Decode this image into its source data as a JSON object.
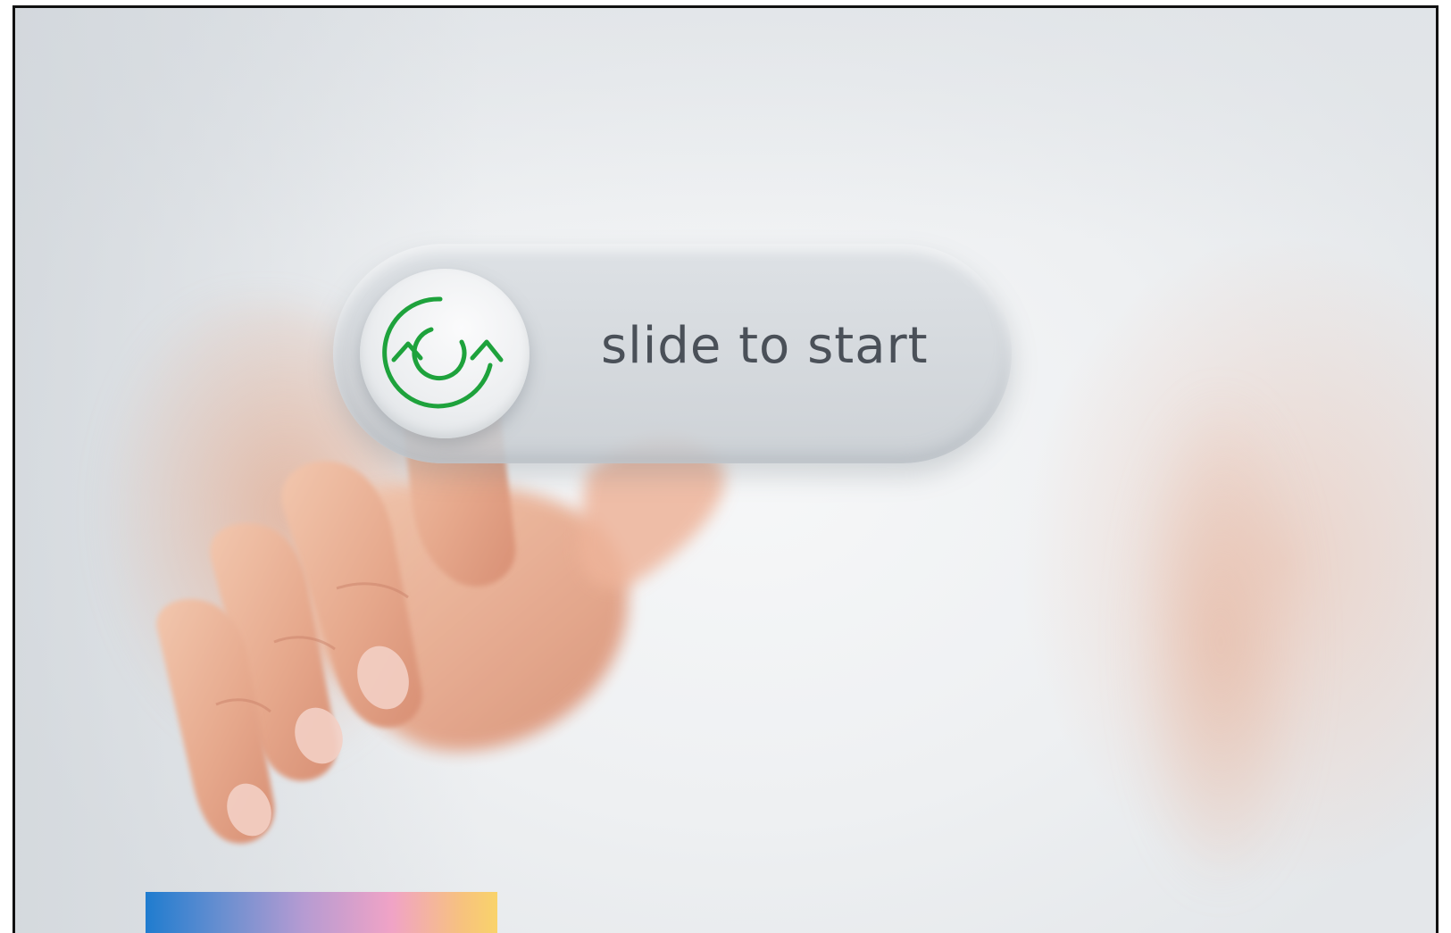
{
  "slider": {
    "label": "slide to start",
    "knob_icon": "refresh-arrows-icon",
    "icon_color": "#1ea23c",
    "progress": 0
  },
  "colors": {
    "label_text": "#4a5058",
    "slider_surface": "#d6dade",
    "background": "#eef0f2",
    "skin": "#e8b49a"
  }
}
